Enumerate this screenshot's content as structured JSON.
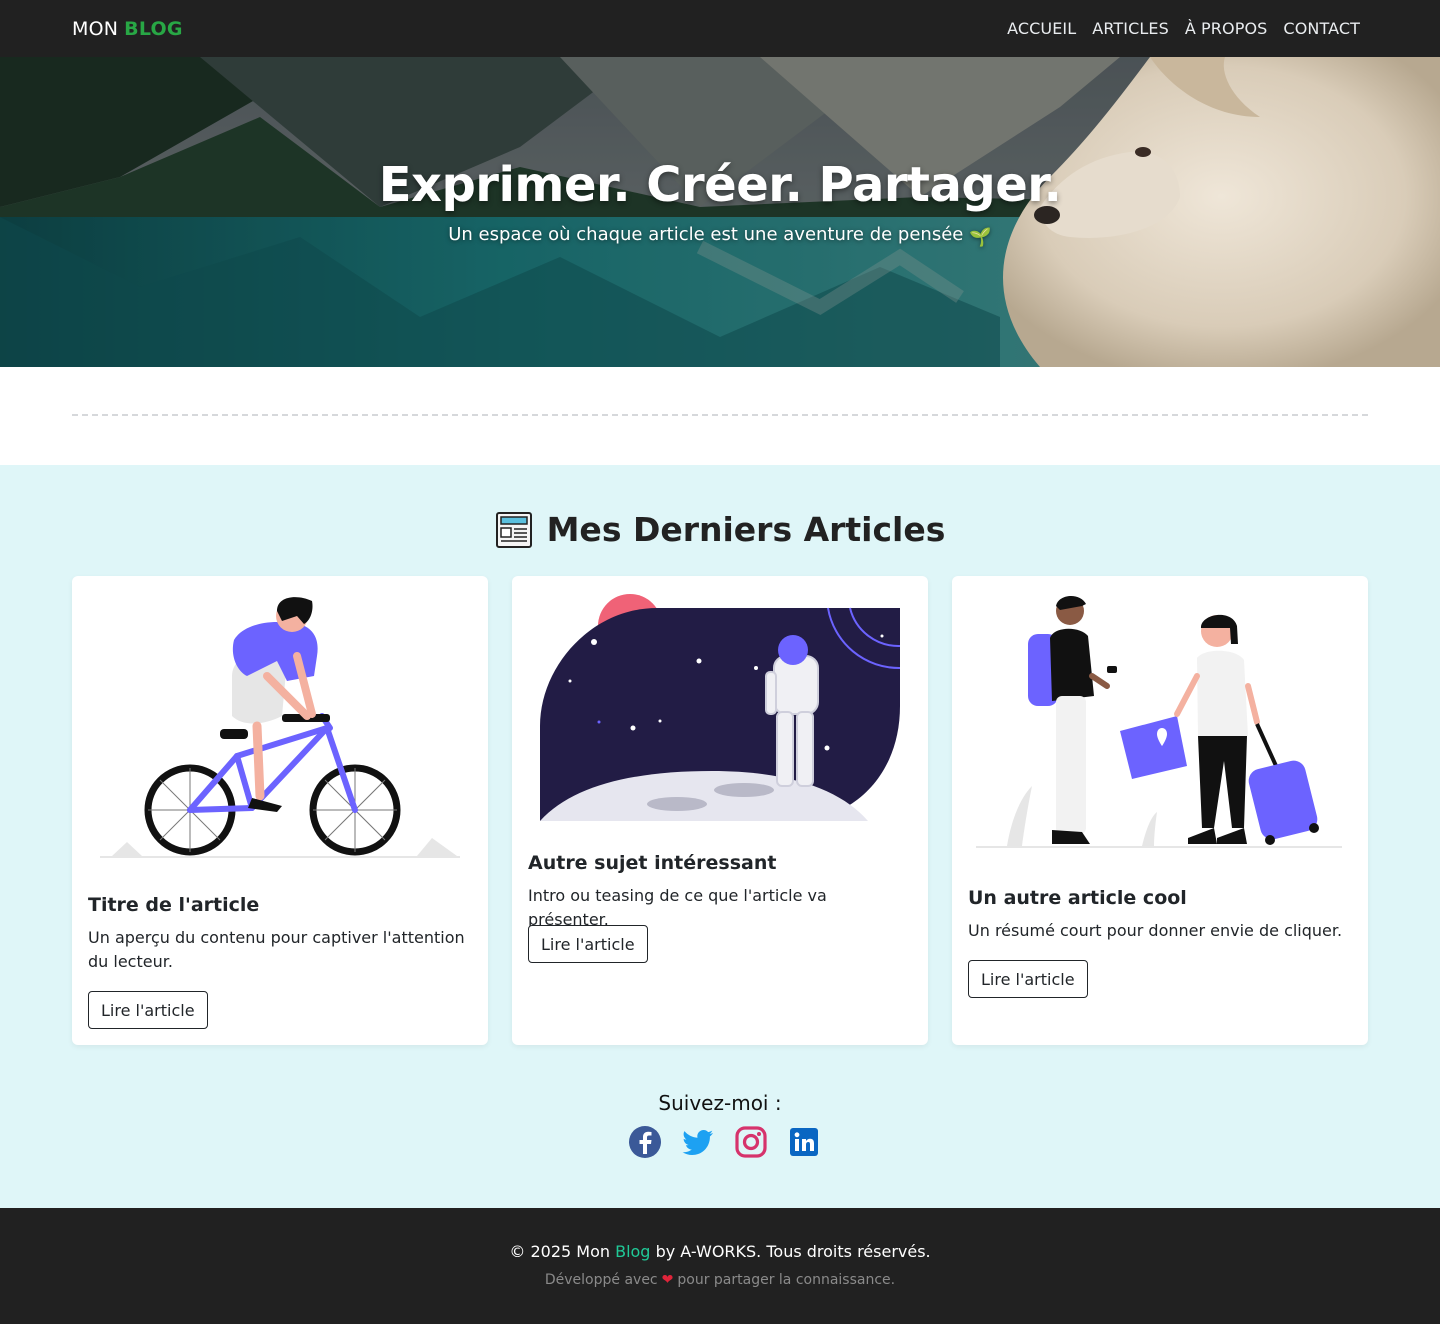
{
  "nav": {
    "brand_main": "MON",
    "brand_accent": "BLOG",
    "links": [
      "ACCUEIL",
      "ARTICLES",
      "À PROPOS",
      "CONTACT"
    ]
  },
  "hero": {
    "title": "Exprimer. Créer. Partager.",
    "subtitle": "Un espace où chaque article est une aventure de pensée",
    "subtitle_emoji": "🌱"
  },
  "articles": {
    "section_icon": "newspaper-icon",
    "section_title": "Mes Derniers Articles",
    "cards": [
      {
        "illustration": "person-riding-bicycle",
        "title": "Titre de l'article",
        "text": "Un aperçu du contenu pour captiver l'attention du lecteur.",
        "button": "Lire l'article"
      },
      {
        "illustration": "astronaut-on-moon",
        "title": "Autre sujet intéressant",
        "text": "Intro ou teasing de ce que l'article va présenter.",
        "button": "Lire l'article"
      },
      {
        "illustration": "travelers-with-map-and-suitcase",
        "title": "Un autre article cool",
        "text": "Un résumé court pour donner envie de cliquer.",
        "button": "Lire l'article"
      }
    ]
  },
  "follow": {
    "label": "Suivez-moi :",
    "networks": [
      {
        "icon": "facebook-icon",
        "color": "#3b5998"
      },
      {
        "icon": "twitter-icon",
        "color": "#1da1f2"
      },
      {
        "icon": "instagram-icon",
        "color": "#d6336c"
      },
      {
        "icon": "linkedin-icon",
        "color": "#0a66c2"
      }
    ]
  },
  "footer": {
    "copy_prefix": "© 2025 Mon",
    "copy_highlight": "Blog",
    "copy_suffix": "by A-WORKS. Tous droits réservés.",
    "dev_prefix": "Développé avec",
    "dev_heart": "❤",
    "dev_suffix": "pour partager la connaissance."
  },
  "colors": {
    "navbar_bg": "#212121",
    "brand_accent": "#28a745",
    "section_bg": "#dff6f8",
    "footer_highlight": "#20c997",
    "illustration_accent": "#6c63ff"
  }
}
